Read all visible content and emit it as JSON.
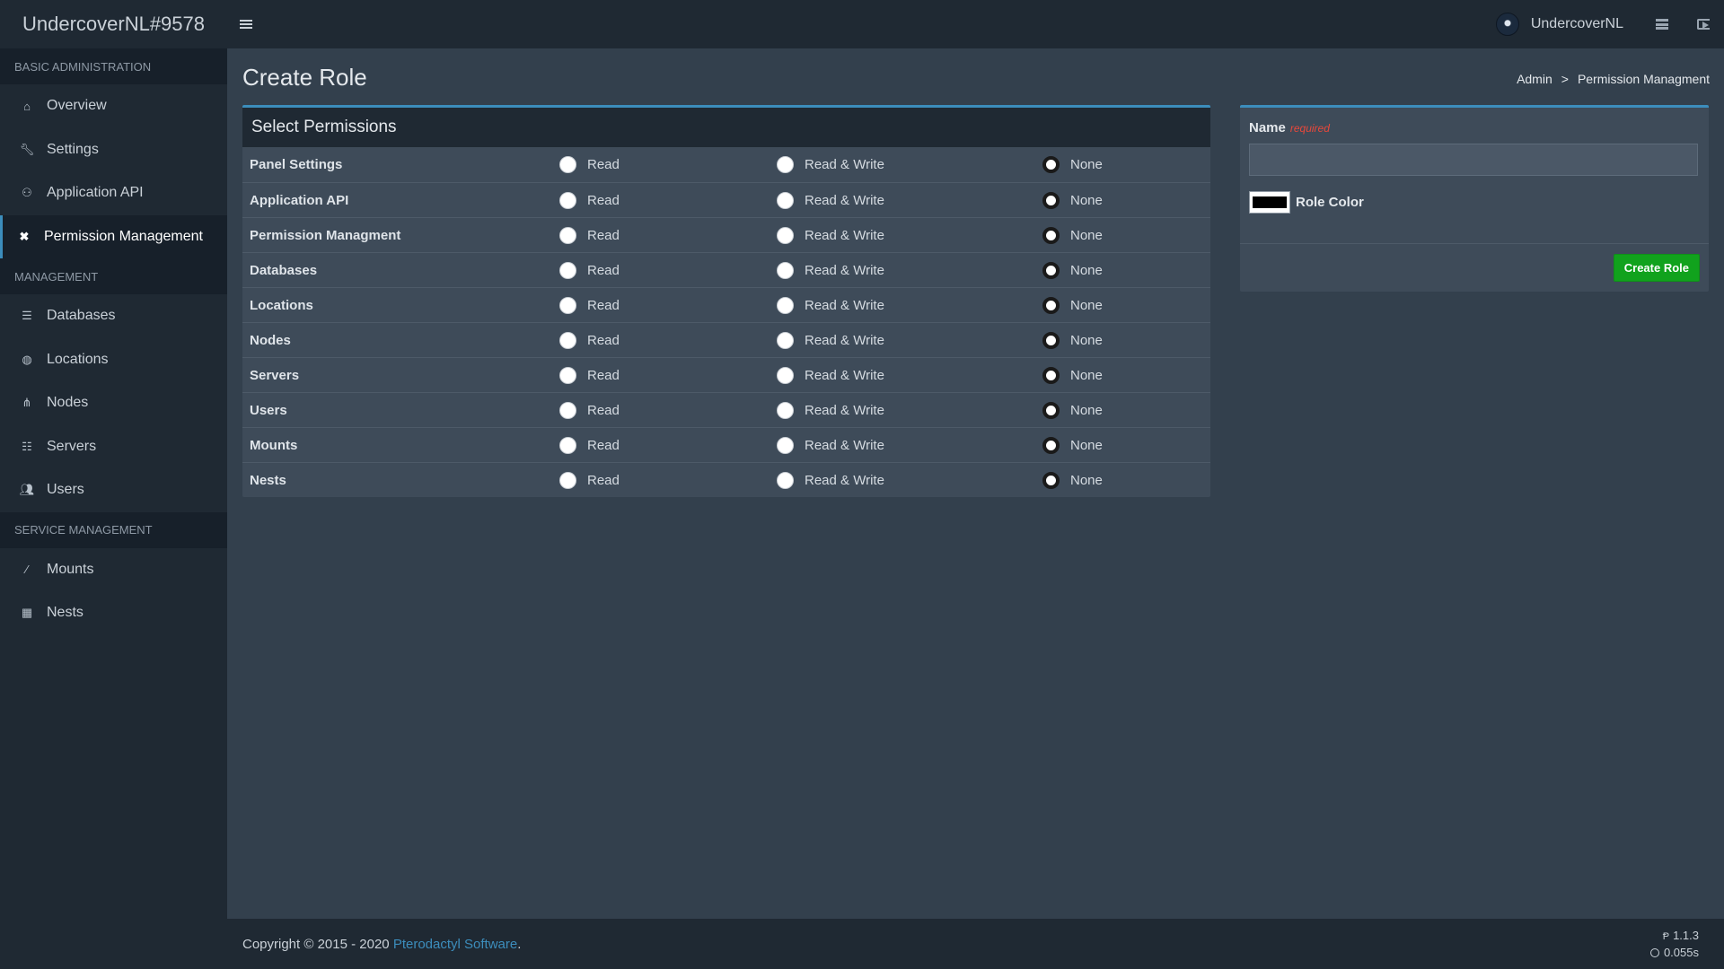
{
  "header": {
    "brand": "UndercoverNL#9578",
    "user_name": "UndercoverNL"
  },
  "sidebar": {
    "sections": [
      {
        "title": "BASIC ADMINISTRATION",
        "items": [
          {
            "label": "Overview",
            "icon": "home-icon"
          },
          {
            "label": "Settings",
            "icon": "wrench-icon"
          },
          {
            "label": "Application API",
            "icon": "gamepad-icon"
          },
          {
            "label": "Permission Management",
            "icon": "close-icon",
            "active": true
          }
        ]
      },
      {
        "title": "MANAGEMENT",
        "items": [
          {
            "label": "Databases",
            "icon": "database-icon"
          },
          {
            "label": "Locations",
            "icon": "globe-icon"
          },
          {
            "label": "Nodes",
            "icon": "sitemap-icon"
          },
          {
            "label": "Servers",
            "icon": "server-icon"
          },
          {
            "label": "Users",
            "icon": "users-icon"
          }
        ]
      },
      {
        "title": "SERVICE MANAGEMENT",
        "items": [
          {
            "label": "Mounts",
            "icon": "magic-icon"
          },
          {
            "label": "Nests",
            "icon": "th-large-icon"
          }
        ]
      }
    ]
  },
  "page": {
    "title": "Create Role",
    "breadcrumb": {
      "root": "Admin",
      "separator": ">",
      "current": "Permission Managment"
    }
  },
  "permissions": {
    "title": "Select Permissions",
    "option_labels": {
      "read": "Read",
      "read_write": "Read & Write",
      "none": "None"
    },
    "rows": [
      {
        "name": "Panel Settings",
        "selected": "none"
      },
      {
        "name": "Application API",
        "selected": "none"
      },
      {
        "name": "Permission Managment",
        "selected": "none"
      },
      {
        "name": "Databases",
        "selected": "none"
      },
      {
        "name": "Locations",
        "selected": "none"
      },
      {
        "name": "Nodes",
        "selected": "none"
      },
      {
        "name": "Servers",
        "selected": "none"
      },
      {
        "name": "Users",
        "selected": "none"
      },
      {
        "name": "Mounts",
        "selected": "none"
      },
      {
        "name": "Nests",
        "selected": "none"
      }
    ]
  },
  "role_form": {
    "name_label": "Name",
    "required_label": "required",
    "name_value": "",
    "color_label": "Role Color",
    "color_value": "#000000",
    "submit_label": "Create Role"
  },
  "footer": {
    "copyright_prefix": "Copyright © 2015 - 2020 ",
    "link_text": "Pterodactyl Software",
    "copyright_suffix": ".",
    "version": "1.1.3",
    "load_time": "0.055s"
  },
  "colors": {
    "accent": "#3c8dbc",
    "success": "#11a21d",
    "danger": "#e8483b"
  }
}
